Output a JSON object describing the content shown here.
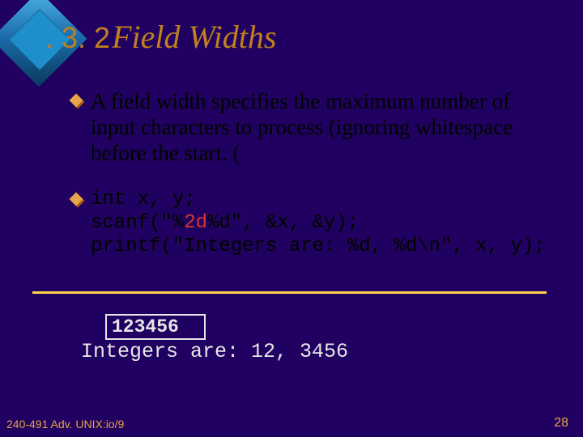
{
  "title": {
    "number": ". 3. 2",
    "text": "Field Widths"
  },
  "bullets": {
    "b1": "A field width specifies the maximum number of input characters to process (ignoring whitespace before the start. (",
    "b2": {
      "line1": "int x, y;",
      "line2a": "scanf(\"%",
      "line2hl": "2d",
      "line2b": "%d\", &x, &y);",
      "line3": "printf(\"Integers are: %d, %d\\n\", x, y);"
    }
  },
  "io": {
    "input": "123456",
    "output": "Integers are: 12, 3456"
  },
  "footer": {
    "left": "240-491 Adv. UNIX:io/9",
    "right": "28"
  }
}
